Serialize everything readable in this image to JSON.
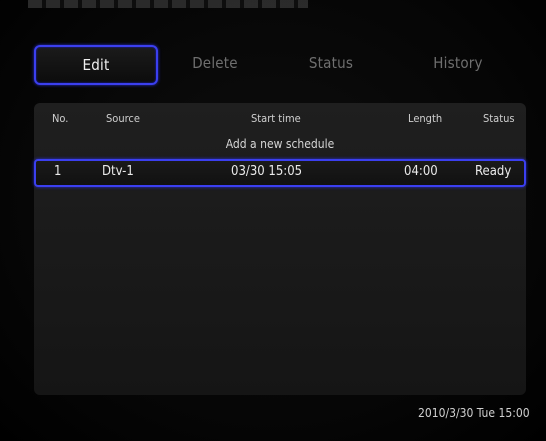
{
  "tabs": {
    "edit": "Edit",
    "delete": "Delete",
    "status": "Status",
    "history": "History"
  },
  "table": {
    "headers": {
      "no": "No.",
      "source": "Source",
      "start_time": "Start time",
      "length": "Length",
      "status": "Status"
    },
    "add_new": "Add a new schedule",
    "rows": [
      {
        "no": "1",
        "source": "Dtv-1",
        "start_time": "03/30 15:05",
        "length": "04:00",
        "status": "Ready"
      }
    ]
  },
  "footer": {
    "clock": "2010/3/30 Tue 15:00"
  },
  "colors": {
    "highlight": "#3b3ff0",
    "background": "#000000",
    "panel": "#1b1b1b"
  }
}
